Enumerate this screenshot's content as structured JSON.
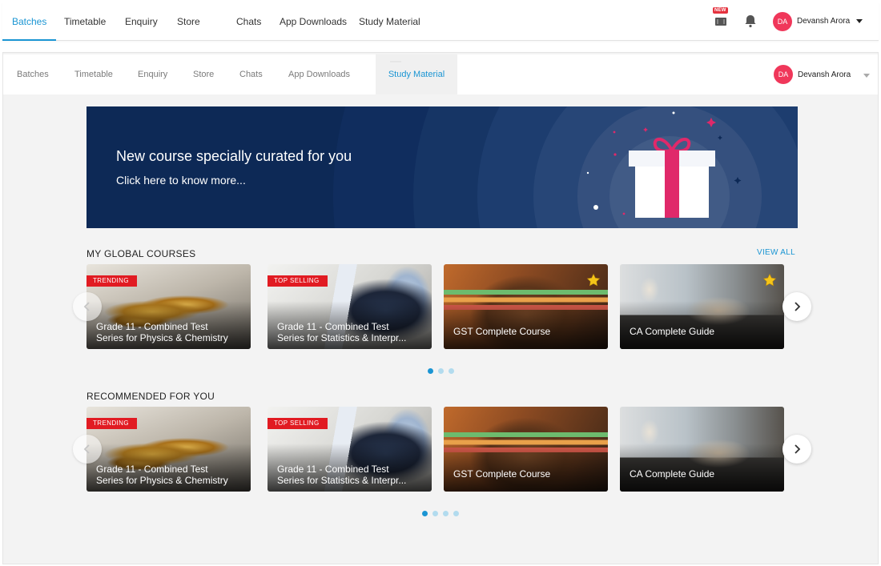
{
  "top_nav": {
    "tabs": [
      {
        "label": "Batches",
        "active": true
      },
      {
        "label": "Timetable"
      },
      {
        "label": "Enquiry"
      },
      {
        "label": "Store"
      },
      {
        "label": "Chats"
      },
      {
        "label": "App Downloads"
      },
      {
        "label": "Study Material"
      }
    ],
    "new_badge": "NEW",
    "icons": [
      "store-icon",
      "bell-icon"
    ],
    "user": {
      "initials": "DA",
      "name": "Devansh Arora"
    }
  },
  "sub_nav": {
    "tabs": [
      {
        "label": "Batches"
      },
      {
        "label": "Timetable"
      },
      {
        "label": "Enquiry"
      },
      {
        "label": "Store"
      },
      {
        "label": "Chats"
      },
      {
        "label": "App Downloads"
      },
      {
        "label": "Study Material",
        "active": true
      }
    ],
    "user": {
      "initials": "DA",
      "name": "Devansh Arora"
    }
  },
  "banner": {
    "title": "New course specially curated for you",
    "subtitle": "Click here to know more...",
    "icon": "gift-icon"
  },
  "global_courses": {
    "heading": "MY GLOBAL COURSES",
    "view_all": "VIEW ALL",
    "cards": [
      {
        "title": "Grade 11 - Combined Test\nSeries for Physics & Chemistry",
        "ribbon": "TRENDING",
        "image": "coins"
      },
      {
        "title": "Grade 11 - Combined Test\nSeries for Statistics & Interpr...",
        "ribbon": "TOP SELLING",
        "image": "tablet"
      },
      {
        "title": "GST Complete Course",
        "star": true,
        "image": "wallet"
      },
      {
        "title": "CA Complete Guide",
        "star": true,
        "image": "classroom"
      }
    ],
    "dots": 3,
    "active_dot": 0
  },
  "recommended": {
    "heading": "RECOMMENDED FOR YOU",
    "cards": [
      {
        "title": "Grade 11 - Combined Test\nSeries for Physics & Chemistry",
        "ribbon": "TRENDING",
        "image": "coins"
      },
      {
        "title": "Grade 11 - Combined Test\nSeries for Statistics & Interpr...",
        "ribbon": "TOP SELLING",
        "image": "tablet"
      },
      {
        "title": "GST Complete Course",
        "image": "wallet"
      },
      {
        "title": "CA Complete Guide",
        "image": "classroom"
      }
    ],
    "dots": 4,
    "active_dot": 0
  },
  "colors": {
    "accent": "#1a95d3",
    "avatar": "#f0375a",
    "banner_bg": "#0d2956",
    "ribbon": "#e11b22",
    "star": "#f5c518"
  }
}
